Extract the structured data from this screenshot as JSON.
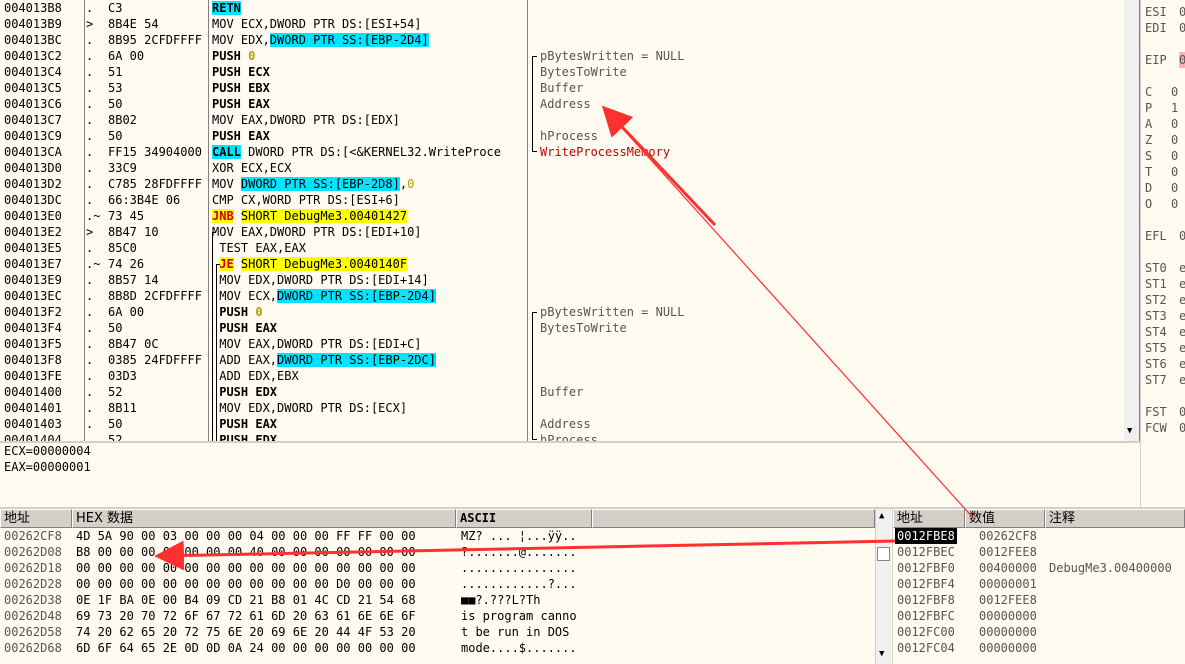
{
  "disasm": [
    {
      "addr": "004013B8",
      "mark": ".",
      "hex": "C3",
      "ins": [
        {
          "t": "RETN",
          "c": "hl-cyan bold"
        }
      ],
      "cmt": "",
      "cmtClass": ""
    },
    {
      "addr": "004013B9",
      "mark": ">",
      "hex": "8B4E 54",
      "ins": [
        {
          "t": "MOV ECX,DWORD PTR DS:[ESI+54]",
          "c": ""
        }
      ],
      "cmt": "",
      "cmtClass": ""
    },
    {
      "addr": "004013BC",
      "mark": ".",
      "hex": "8B95 2CFDFFFF",
      "ins": [
        {
          "t": "MOV EDX,",
          "c": ""
        },
        {
          "t": "DWORD PTR SS:[EBP-2D4]",
          "c": "cyan-box"
        }
      ],
      "cmt": "",
      "cmtClass": ""
    },
    {
      "addr": "004013C2",
      "mark": ".",
      "hex": "6A 00",
      "ins": [
        {
          "t": "PUSH ",
          "c": "bold"
        },
        {
          "t": "0",
          "c": "num bold"
        }
      ],
      "cmt": "pBytesWritten = NULL",
      "cmtClass": ""
    },
    {
      "addr": "004013C4",
      "mark": ".",
      "hex": "51",
      "ins": [
        {
          "t": "PUSH ECX",
          "c": "bold"
        }
      ],
      "cmt": "BytesToWrite",
      "cmtClass": ""
    },
    {
      "addr": "004013C5",
      "mark": ".",
      "hex": "53",
      "ins": [
        {
          "t": "PUSH EBX",
          "c": "bold"
        }
      ],
      "cmt": "Buffer",
      "cmtClass": ""
    },
    {
      "addr": "004013C6",
      "mark": ".",
      "hex": "50",
      "ins": [
        {
          "t": "PUSH EAX",
          "c": "bold"
        }
      ],
      "cmt": "Address",
      "cmtClass": ""
    },
    {
      "addr": "004013C7",
      "mark": ".",
      "hex": "8B02",
      "ins": [
        {
          "t": "MOV EAX,DWORD PTR DS:[EDX]",
          "c": ""
        }
      ],
      "cmt": "",
      "cmtClass": ""
    },
    {
      "addr": "004013C9",
      "mark": ".",
      "hex": "50",
      "ins": [
        {
          "t": "PUSH EAX",
          "c": "bold"
        }
      ],
      "cmt": "hProcess",
      "cmtClass": ""
    },
    {
      "addr": "004013CA",
      "mark": ".",
      "hex": "FF15 34904000",
      "ins": [
        {
          "t": "CALL",
          "c": "hl-cyan bold"
        },
        {
          "t": " DWORD PTR DS:[<&KERNEL32.WriteProce",
          "c": ""
        }
      ],
      "cmt": "WriteProcessMemory",
      "cmtClass": "red"
    },
    {
      "addr": "004013D0",
      "mark": ".",
      "hex": "33C9",
      "ins": [
        {
          "t": "XOR ECX,ECX",
          "c": ""
        }
      ],
      "cmt": "",
      "cmtClass": ""
    },
    {
      "addr": "004013D2",
      "mark": ".",
      "hex": "C785 28FDFFFF",
      "ins": [
        {
          "t": "MOV ",
          "c": ""
        },
        {
          "t": "DWORD PTR SS:[EBP-2D8]",
          "c": "cyan-box"
        },
        {
          "t": ",",
          "c": ""
        },
        {
          "t": "0",
          "c": "num"
        }
      ],
      "cmt": "",
      "cmtClass": ""
    },
    {
      "addr": "004013DC",
      "mark": ".",
      "hex": "66:3B4E 06",
      "ins": [
        {
          "t": "CMP CX,WORD PTR DS:[ESI+6]",
          "c": ""
        }
      ],
      "cmt": "",
      "cmtClass": ""
    },
    {
      "addr": "004013E0",
      "mark": ".~",
      "hex": "73 45",
      "ins": [
        {
          "t": "JNB",
          "c": "kw-red yellow-box"
        },
        {
          "t": " ",
          "c": ""
        },
        {
          "t": "SHORT DebugMe3.00401427",
          "c": "yellow-box"
        }
      ],
      "cmt": "",
      "cmtClass": ""
    },
    {
      "addr": "004013E2",
      "mark": ">",
      "hex": "8B47 10",
      "ins": [
        {
          "t": "MOV EAX,DWORD PTR DS:[EDI+10]",
          "c": ""
        }
      ],
      "cmt": "",
      "cmtClass": ""
    },
    {
      "addr": "004013E5",
      "mark": ".",
      "hex": "85C0",
      "ins": [
        {
          "t": " TEST EAX,EAX",
          "c": ""
        }
      ],
      "cmt": "",
      "cmtClass": ""
    },
    {
      "addr": "004013E7",
      "mark": ".~",
      "hex": "74 26",
      "ins": [
        {
          "t": " ",
          "c": ""
        },
        {
          "t": "JE",
          "c": "kw-red yellow-box"
        },
        {
          "t": " ",
          "c": ""
        },
        {
          "t": "SHORT DebugMe3.0040140F",
          "c": "yellow-box"
        }
      ],
      "cmt": "",
      "cmtClass": ""
    },
    {
      "addr": "004013E9",
      "mark": ".",
      "hex": "8B57 14",
      "ins": [
        {
          "t": " MOV EDX,DWORD PTR DS:[EDI+14]",
          "c": ""
        }
      ],
      "cmt": "",
      "cmtClass": ""
    },
    {
      "addr": "004013EC",
      "mark": ".",
      "hex": "8B8D 2CFDFFFF",
      "ins": [
        {
          "t": " MOV ECX,",
          "c": ""
        },
        {
          "t": "DWORD PTR SS:[EBP-2D4]",
          "c": "cyan-box"
        }
      ],
      "cmt": "",
      "cmtClass": ""
    },
    {
      "addr": "004013F2",
      "mark": ".",
      "hex": "6A 00",
      "ins": [
        {
          "t": " PUSH ",
          "c": "bold"
        },
        {
          "t": "0",
          "c": "num bold"
        }
      ],
      "cmt": "pBytesWritten = NULL",
      "cmtClass": ""
    },
    {
      "addr": "004013F4",
      "mark": ".",
      "hex": "50",
      "ins": [
        {
          "t": " PUSH EAX",
          "c": "bold"
        }
      ],
      "cmt": "BytesToWrite",
      "cmtClass": ""
    },
    {
      "addr": "004013F5",
      "mark": ".",
      "hex": "8B47 0C",
      "ins": [
        {
          "t": " MOV EAX,DWORD PTR DS:[EDI+C]",
          "c": ""
        }
      ],
      "cmt": "",
      "cmtClass": ""
    },
    {
      "addr": "004013F8",
      "mark": ".",
      "hex": "0385 24FDFFFF",
      "ins": [
        {
          "t": " ADD EAX,",
          "c": ""
        },
        {
          "t": "DWORD PTR SS:[EBP-2DC]",
          "c": "cyan-box"
        }
      ],
      "cmt": "",
      "cmtClass": ""
    },
    {
      "addr": "004013FE",
      "mark": ".",
      "hex": "03D3",
      "ins": [
        {
          "t": " ADD EDX,EBX",
          "c": ""
        }
      ],
      "cmt": "",
      "cmtClass": ""
    },
    {
      "addr": "00401400",
      "mark": ".",
      "hex": "52",
      "ins": [
        {
          "t": " PUSH EDX",
          "c": "bold"
        }
      ],
      "cmt": "Buffer",
      "cmtClass": ""
    },
    {
      "addr": "00401401",
      "mark": ".",
      "hex": "8B11",
      "ins": [
        {
          "t": " MOV EDX,DWORD PTR DS:[ECX]",
          "c": ""
        }
      ],
      "cmt": "",
      "cmtClass": ""
    },
    {
      "addr": "00401403",
      "mark": ".",
      "hex": "50",
      "ins": [
        {
          "t": " PUSH EAX",
          "c": "bold"
        }
      ],
      "cmt": "Address",
      "cmtClass": ""
    },
    {
      "addr": "00401404",
      "mark": ".",
      "hex": "52",
      "ins": [
        {
          "t": " PUSH EDX",
          "c": "bold"
        }
      ],
      "cmt": "hProcess",
      "cmtClass": ""
    }
  ],
  "registers": [
    {
      "label": "ESI",
      "val": "0"
    },
    {
      "label": "EDI",
      "val": "0"
    },
    {
      "label": "",
      "val": ""
    },
    {
      "label": "EIP",
      "val": "0"
    },
    {
      "label": "",
      "val": ""
    },
    {
      "label": "C",
      "val": "0"
    },
    {
      "label": "P",
      "val": "1"
    },
    {
      "label": "A",
      "val": "0"
    },
    {
      "label": "Z",
      "val": "0"
    },
    {
      "label": "S",
      "val": "0"
    },
    {
      "label": "T",
      "val": "0"
    },
    {
      "label": "D",
      "val": "0"
    },
    {
      "label": "O",
      "val": "0"
    },
    {
      "label": "",
      "val": ""
    },
    {
      "label": "EFL",
      "val": "0"
    },
    {
      "label": "",
      "val": ""
    },
    {
      "label": "ST0",
      "val": "e"
    },
    {
      "label": "ST1",
      "val": "e"
    },
    {
      "label": "ST2",
      "val": "e"
    },
    {
      "label": "ST3",
      "val": "e"
    },
    {
      "label": "ST4",
      "val": "e"
    },
    {
      "label": "ST5",
      "val": "e"
    },
    {
      "label": "ST6",
      "val": "e"
    },
    {
      "label": "ST7",
      "val": "e"
    },
    {
      "label": "",
      "val": ""
    },
    {
      "label": "FST",
      "val": "0"
    },
    {
      "label": "FCW",
      "val": "0"
    }
  ],
  "info": {
    "line1": "ECX=00000004",
    "line2": "EAX=00000001"
  },
  "dump": {
    "headers": {
      "addr": "地址",
      "hex": "HEX 数据",
      "ascii": "ASCII"
    },
    "rows": [
      {
        "addr": "00262CF8",
        "hex": "4D 5A 90 00 03 00 00 00 04 00 00 00 FF FF 00 00",
        "ascii": "MZ? ... ¦...ÿÿ.."
      },
      {
        "addr": "00262D08",
        "hex": "B8 00 00 00 00 00 00 00 40 00 00 00 00 00 00 00",
        "ascii": "?.......@......."
      },
      {
        "addr": "00262D18",
        "hex": "00 00 00 00 00 00 00 00 00 00 00 00 00 00 00 00",
        "ascii": "................"
      },
      {
        "addr": "00262D28",
        "hex": "00 00 00 00 00 00 00 00 00 00 00 00 D0 00 00 00",
        "ascii": "............?..."
      },
      {
        "addr": "00262D38",
        "hex": "0E 1F BA 0E 00 B4 09 CD 21 B8 01 4C CD 21 54 68",
        "ascii": "■■?.???L?Th"
      },
      {
        "addr": "00262D48",
        "hex": "69 73 20 70 72 6F 67 72 61 6D 20 63 61 6E 6E 6F",
        "ascii": "is program canno"
      },
      {
        "addr": "00262D58",
        "hex": "74 20 62 65 20 72 75 6E 20 69 6E 20 44 4F 53 20",
        "ascii": "t be run in DOS "
      },
      {
        "addr": "00262D68",
        "hex": "6D 6F 64 65 2E 0D 0D 0A 24 00 00 00 00 00 00 00",
        "ascii": "mode....$......."
      }
    ]
  },
  "stack": {
    "headers": {
      "addr": "地址",
      "val": "数值",
      "cmt": "注释"
    },
    "rows": [
      {
        "addr": "0012FBE8",
        "val": "00262CF8",
        "cmt": "",
        "sel": true
      },
      {
        "addr": "0012FBEC",
        "val": "0012FEE8",
        "cmt": "",
        "sel": false
      },
      {
        "addr": "0012FBF0",
        "val": "00400000",
        "cmt": "DebugMe3.00400000",
        "sel": false
      },
      {
        "addr": "0012FBF4",
        "val": "00000001",
        "cmt": "",
        "sel": false
      },
      {
        "addr": "0012FBF8",
        "val": "0012FEE8",
        "cmt": "",
        "sel": false
      },
      {
        "addr": "0012FBFC",
        "val": "00000000",
        "cmt": "",
        "sel": false
      },
      {
        "addr": "0012FC00",
        "val": "00000000",
        "cmt": "",
        "sel": false
      },
      {
        "addr": "0012FC04",
        "val": "00000000",
        "cmt": "",
        "sel": false
      }
    ]
  },
  "colors": {
    "arrow": "#ff3030",
    "cyan": "#00e5ff",
    "yellow": "#ffff00",
    "keyword": "#d00000"
  }
}
